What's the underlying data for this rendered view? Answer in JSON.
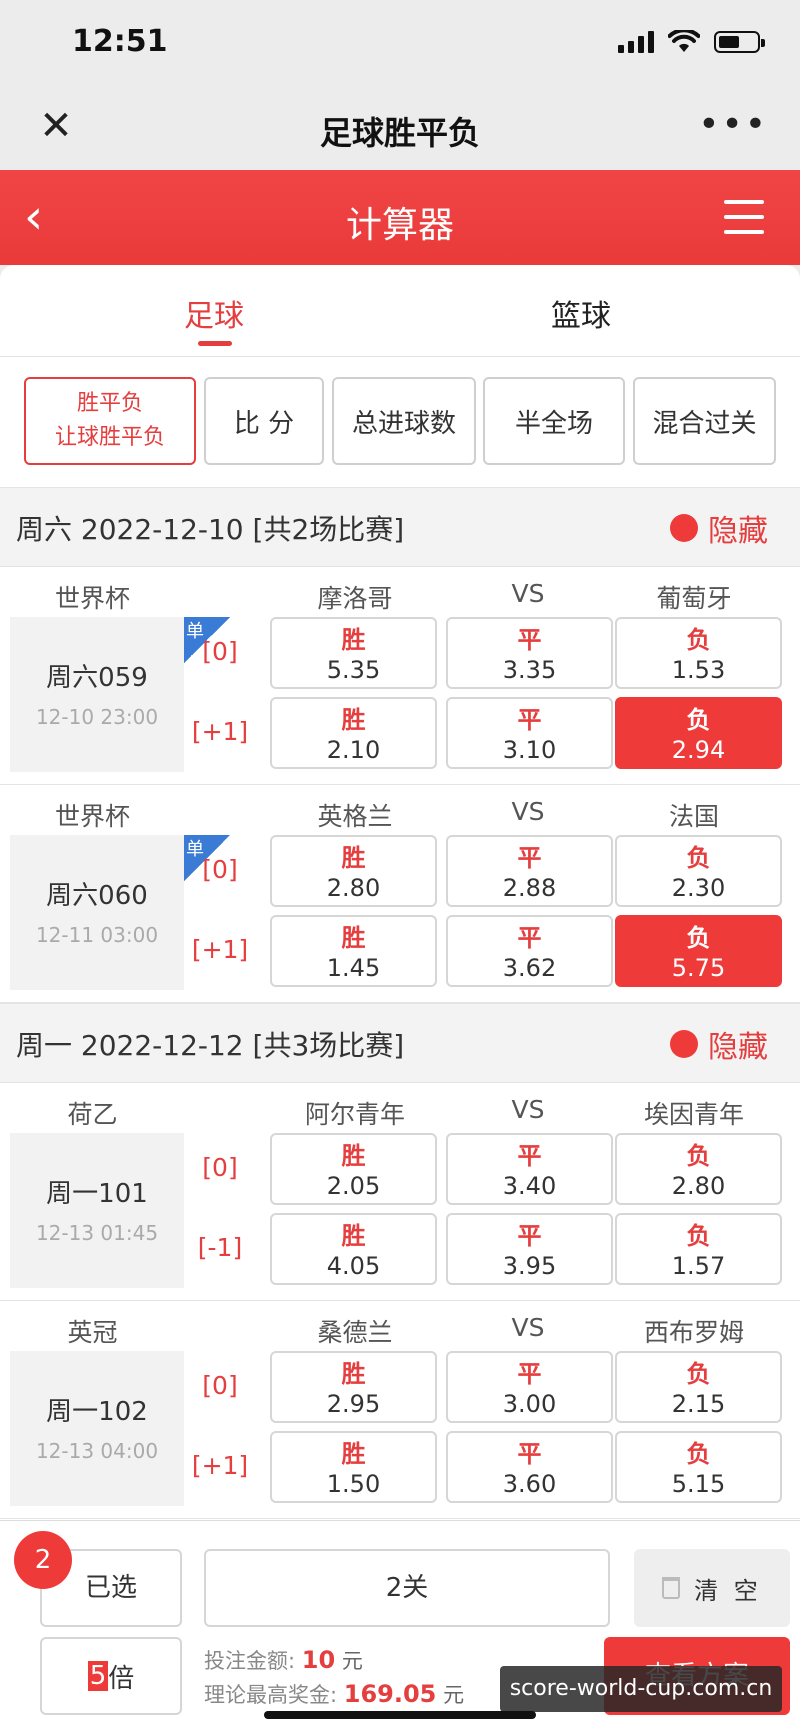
{
  "status": {
    "time": "12:51"
  },
  "webview": {
    "title": "足球胜平负",
    "close_icon": "close-icon",
    "more": "•••"
  },
  "header": {
    "title": "计算器",
    "back_icon": "chevron-left-icon",
    "menu_icon": "list-menu-icon",
    "accent": "#ef3a3a"
  },
  "sport_tabs": [
    {
      "label": "足球",
      "active": true
    },
    {
      "label": "篮球",
      "active": false
    }
  ],
  "play_types": {
    "active_line1": "胜平负",
    "active_line2": "让球胜平负",
    "items": [
      "比 分",
      "总进球数",
      "半全场",
      "混合过关"
    ]
  },
  "groups": [
    {
      "date": "周六 2022-12-10 [共2场比赛]",
      "hide_label": "隐藏",
      "matches": [
        {
          "league": "世界杯",
          "home": "摩洛哥",
          "vs": "VS",
          "away": "葡萄牙",
          "number": "周六059",
          "time": "12-10 23:00",
          "single": "单",
          "rows": [
            {
              "handicap": "[0]",
              "odds": [
                {
                  "label": "胜",
                  "value": "5.35"
                },
                {
                  "label": "平",
                  "value": "3.35"
                },
                {
                  "label": "负",
                  "value": "1.53"
                }
              ],
              "selected_index": null
            },
            {
              "handicap": "[+1]",
              "odds": [
                {
                  "label": "胜",
                  "value": "2.10"
                },
                {
                  "label": "平",
                  "value": "3.10"
                },
                {
                  "label": "负",
                  "value": "2.94"
                }
              ],
              "selected_index": 2
            }
          ]
        },
        {
          "league": "世界杯",
          "home": "英格兰",
          "vs": "VS",
          "away": "法国",
          "number": "周六060",
          "time": "12-11 03:00",
          "single": "单",
          "rows": [
            {
              "handicap": "[0]",
              "odds": [
                {
                  "label": "胜",
                  "value": "2.80"
                },
                {
                  "label": "平",
                  "value": "2.88"
                },
                {
                  "label": "负",
                  "value": "2.30"
                }
              ],
              "selected_index": null
            },
            {
              "handicap": "[+1]",
              "odds": [
                {
                  "label": "胜",
                  "value": "1.45"
                },
                {
                  "label": "平",
                  "value": "3.62"
                },
                {
                  "label": "负",
                  "value": "5.75"
                }
              ],
              "selected_index": 2
            }
          ]
        }
      ]
    },
    {
      "date": "周一 2022-12-12 [共3场比赛]",
      "hide_label": "隐藏",
      "matches": [
        {
          "league": "荷乙",
          "home": "阿尔青年",
          "vs": "VS",
          "away": "埃因青年",
          "number": "周一101",
          "time": "12-13 01:45",
          "single": "",
          "rows": [
            {
              "handicap": "[0]",
              "odds": [
                {
                  "label": "胜",
                  "value": "2.05"
                },
                {
                  "label": "平",
                  "value": "3.40"
                },
                {
                  "label": "负",
                  "value": "2.80"
                }
              ],
              "selected_index": null
            },
            {
              "handicap": "[-1]",
              "odds": [
                {
                  "label": "胜",
                  "value": "4.05"
                },
                {
                  "label": "平",
                  "value": "3.95"
                },
                {
                  "label": "负",
                  "value": "1.57"
                }
              ],
              "selected_index": null
            }
          ]
        },
        {
          "league": "英冠",
          "home": "桑德兰",
          "vs": "VS",
          "away": "西布罗姆",
          "number": "周一102",
          "time": "12-13 04:00",
          "single": "",
          "rows": [
            {
              "handicap": "[0]",
              "odds": [
                {
                  "label": "胜",
                  "value": "2.95"
                },
                {
                  "label": "平",
                  "value": "3.00"
                },
                {
                  "label": "负",
                  "value": "2.15"
                }
              ],
              "selected_index": null
            },
            {
              "handicap": "[+1]",
              "odds": [
                {
                  "label": "胜",
                  "value": "1.50"
                },
                {
                  "label": "平",
                  "value": "3.60"
                },
                {
                  "label": "负",
                  "value": "5.15"
                }
              ],
              "selected_index": null
            }
          ]
        }
      ]
    }
  ],
  "bottom": {
    "count": "2",
    "selected_label": "已选",
    "pass_label": "2关",
    "clear_label": "清 空",
    "multiplier": "5",
    "multiplier_unit": "倍",
    "bet_label": "投注金额:",
    "bet_amount": "10",
    "bet_unit": "元",
    "max_label": "理论最高奖金:",
    "max_amount": "169.05",
    "max_unit": "元",
    "view_label": "查看方案"
  },
  "watermark": "score-world-cup.com.cn"
}
